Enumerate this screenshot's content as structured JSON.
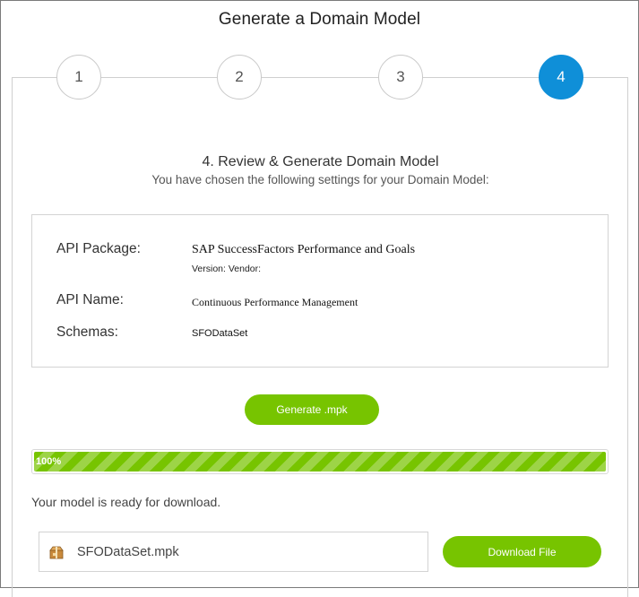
{
  "dialog": {
    "title": "Generate a Domain Model"
  },
  "steps": [
    {
      "label": "1",
      "active": false
    },
    {
      "label": "2",
      "active": false
    },
    {
      "label": "3",
      "active": false
    },
    {
      "label": "4",
      "active": true
    }
  ],
  "review": {
    "heading": "4. Review & Generate Domain Model",
    "subheading": "You have chosen the following settings for your Domain Model:"
  },
  "summary": {
    "api_package_label": "API Package:",
    "api_package_value": "SAP SuccessFactors Performance and Goals",
    "version_text": "Version: Vendor:",
    "api_name_label": "API Name:",
    "api_name_value": "Continuous Performance Management",
    "schemas_label": "Schemas:",
    "schemas_value": "SFODataSet"
  },
  "generate_button": {
    "label": "Generate .mpk"
  },
  "progress": {
    "value": 1.0,
    "text": "100%"
  },
  "status_message": "Your model is ready for download.",
  "file": {
    "name": "SFODataSet.mpk",
    "icon": "package-icon"
  },
  "download_button": {
    "label": "Download File"
  },
  "colors": {
    "accent_blue": "#0f8fd8",
    "accent_green": "#77c400"
  }
}
